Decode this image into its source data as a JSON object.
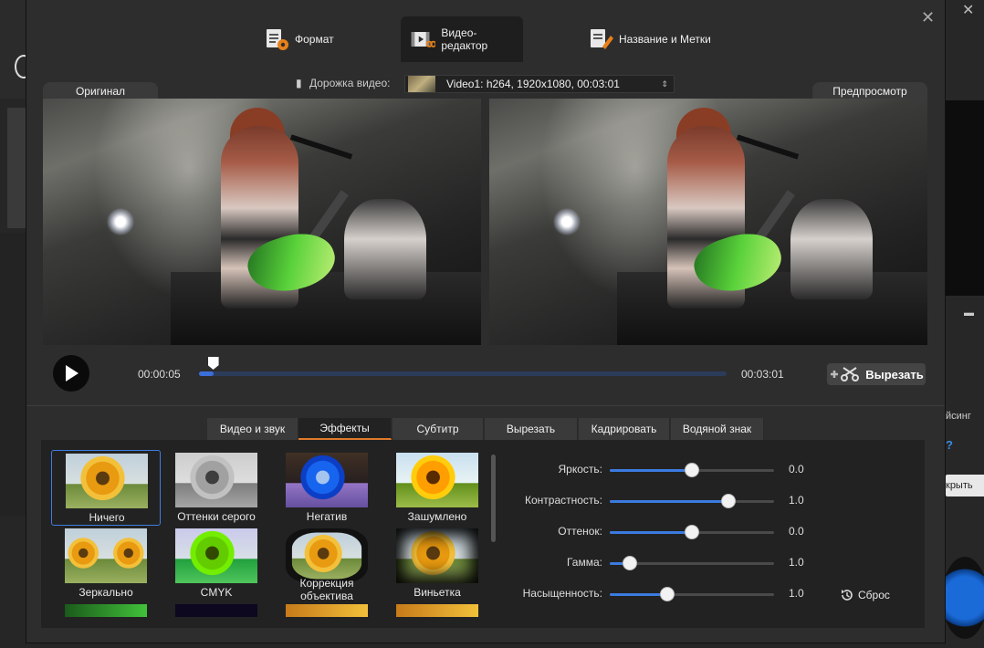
{
  "tabs": [
    {
      "label": "Формат",
      "icon": "format-icon"
    },
    {
      "label": "Видео-редактор",
      "icon": "video-editor-icon",
      "active": true
    },
    {
      "label": "Название и Метки",
      "icon": "tags-icon"
    }
  ],
  "video_track": {
    "label": "Дорожка видео:",
    "value": "Video1: h264, 1920x1080, 00:03:01"
  },
  "panes": {
    "original": "Оригинал",
    "preview": "Предпросмотр"
  },
  "player": {
    "current_time": "00:00:05",
    "total_time": "00:03:01",
    "position_fraction": 0.027,
    "cut_label": "Вырезать"
  },
  "subtabs": [
    {
      "label": "Видео и звук"
    },
    {
      "label": "Эффекты",
      "active": true
    },
    {
      "label": "Субтитр"
    },
    {
      "label": "Вырезать"
    },
    {
      "label": "Кадрировать"
    },
    {
      "label": "Водяной знак"
    }
  ],
  "effects": [
    {
      "label": "Ничего",
      "selected": true
    },
    {
      "label": "Оттенки серого"
    },
    {
      "label": "Негатив"
    },
    {
      "label": "Зашумлено"
    },
    {
      "label": "Зеркально"
    },
    {
      "label": "CMYK"
    },
    {
      "label": "Коррекция объектива"
    },
    {
      "label": "Виньетка"
    }
  ],
  "adjustments": [
    {
      "label": "Яркость:",
      "value": "0.0",
      "fraction": 0.5
    },
    {
      "label": "Контрастность:",
      "value": "1.0",
      "fraction": 0.72
    },
    {
      "label": "Оттенок:",
      "value": "0.0",
      "fraction": 0.5
    },
    {
      "label": "Гамма:",
      "value": "1.0",
      "fraction": 0.12
    },
    {
      "label": "Насыщенность:",
      "value": "1.0",
      "fraction": 0.35
    }
  ],
  "reset_label": "Сброс",
  "background": {
    "fragment_1": "йсинг",
    "fragment_2": "?",
    "fragment_3": "крыть"
  },
  "colors": {
    "accent_blue": "#3b7be0",
    "active_tab_underline": "#e07a2a"
  }
}
